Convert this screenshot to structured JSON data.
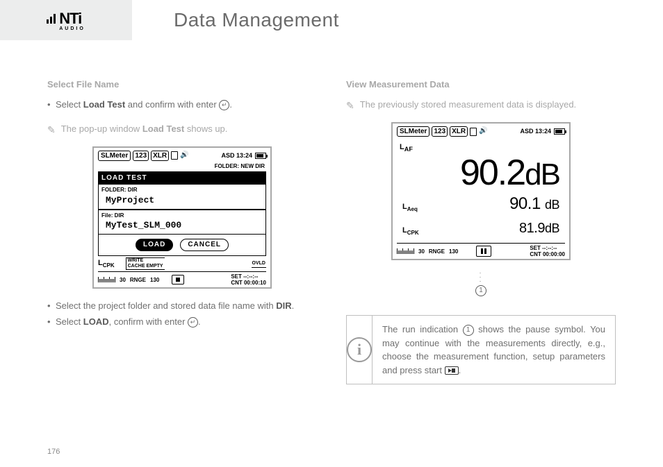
{
  "header": {
    "logo_main": "NTi",
    "logo_sub": "AUDIO",
    "title": "Data Management"
  },
  "left": {
    "section_title": "Select File Name",
    "bullet1_pre": "Select ",
    "bullet1_bold": "Load Test",
    "bullet1_post": " and confirm with enter ",
    "hand_pre": "The pop-up window ",
    "hand_bold": "Load Test",
    "hand_post": " shows up.",
    "bullet2_pre": "Select the project folder and stored data file name with ",
    "bullet2_bold": "DIR",
    "bullet3_pre": "Select ",
    "bullet3_bold": "LOAD",
    "bullet3_post": ", confirm with enter "
  },
  "right": {
    "section_title": "View Measurement Data",
    "hand_text": "The previously stored measurement data is displayed.",
    "info_text_1": "The run indication ",
    "info_text_2": " shows the pause symbol. You may continue with the measurements directly, e.g., choose the measurement function, setup parameters and press start "
  },
  "lcd1": {
    "tab1": "SLMeter",
    "tab2": "123",
    "tab3": "XLR",
    "top_right": "ASD 13:24",
    "folder_line": "FOLDER: NEW DIR",
    "popup_title": "LOAD TEST",
    "row1_label": "FOLDER: DIR",
    "row1_val": "MyProject",
    "row2_label": "File:   DIR",
    "row2_val": "MyTest_SLM_000",
    "btn_load": "LOAD",
    "btn_cancel": "CANCEL",
    "lcpk": "LCPK",
    "bracket_l1": "WRITE",
    "bracket_l2": "CACHE  EMPTY",
    "ovld": "OVLD",
    "rnge_lo": "30",
    "rnge": "RNGE",
    "rnge_hi": "130",
    "set": "SET --:--:--",
    "cnt": "CNT 00:00:10"
  },
  "lcd2": {
    "tab1": "SLMeter",
    "tab2": "123",
    "tab3": "XLR",
    "top_right": "ASD 13:24",
    "laf": "LAF",
    "big_val": "90.2",
    "big_unit": "dB",
    "laeq": "LAeq",
    "laeq_val": "90.1",
    "laeq_unit": "dB",
    "lcpk": "LCPK",
    "lcpk_val": "81.9",
    "lcpk_unit": "dB",
    "rnge_lo": "30",
    "rnge": "RNGE",
    "rnge_hi": "130",
    "set": "SET --:--:--",
    "cnt": "CNT 00:00:00"
  },
  "callout_num": "1",
  "page_number": "176"
}
